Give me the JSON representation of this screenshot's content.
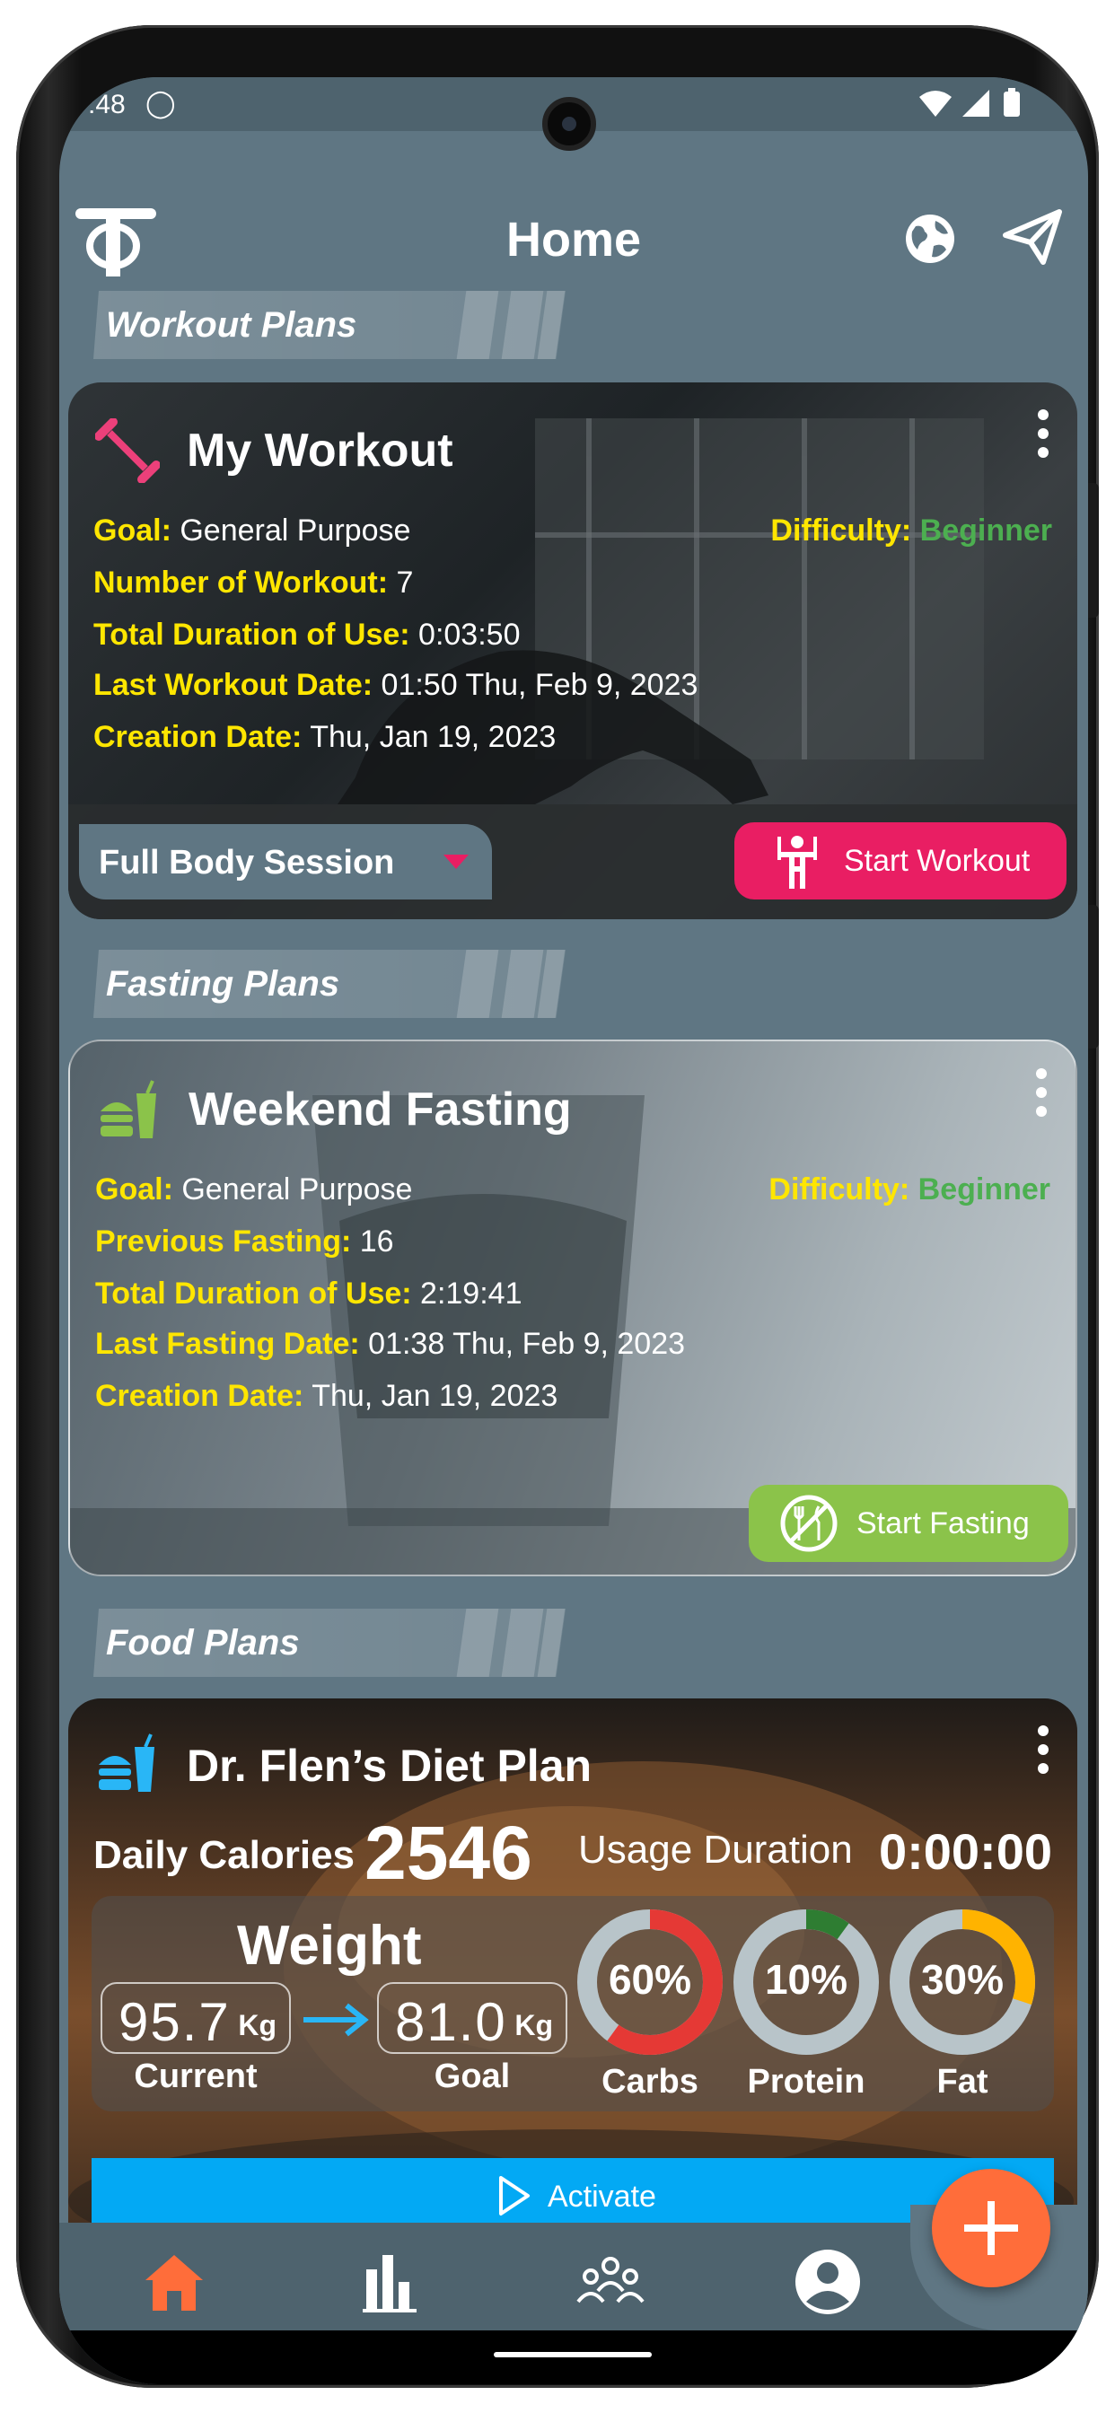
{
  "status_bar": {
    "time": ":48",
    "right_icons": "wifi signal battery"
  },
  "header": {
    "title": "Home"
  },
  "workout": {
    "section_label": "Workout Plans",
    "title": "My Workout",
    "goal_key": "Goal:",
    "goal_val": "General Purpose",
    "difficulty_key": "Difficulty:",
    "difficulty_val": "Beginner",
    "count_key": "Number of Workout:",
    "count_val": "7",
    "duration_key": "Total Duration of Use:",
    "duration_val": "0:03:50",
    "last_key": "Last Workout Date:",
    "last_val": "01:50 Thu, Feb 9, 2023",
    "created_key": "Creation Date:",
    "created_val": "Thu, Jan 19, 2023",
    "session_select": "Full Body Session",
    "start_label": "Start Workout"
  },
  "fasting": {
    "section_label": "Fasting Plans",
    "title": "Weekend Fasting",
    "goal_key": "Goal:",
    "goal_val": "General Purpose",
    "difficulty_key": "Difficulty:",
    "difficulty_val": "Beginner",
    "count_key": "Previous Fasting:",
    "count_val": "16",
    "duration_key": "Total Duration of Use:",
    "duration_val": "2:19:41",
    "last_key": "Last Fasting Date:",
    "last_val": "01:38 Thu, Feb 9, 2023",
    "created_key": "Creation Date:",
    "created_val": "Thu, Jan 19, 2023",
    "start_label": "Start Fasting"
  },
  "food": {
    "section_label": "Food Plans",
    "title": "Dr. Flen’s Diet Plan",
    "calories_label": "Daily Calories",
    "calories_value": "2546",
    "usage_label": "Usage Duration",
    "usage_value": "0:00:00",
    "weight_title": "Weight",
    "current_weight": "95.7",
    "goal_weight": "81.0",
    "unit": "Kg",
    "current_label": "Current",
    "goal_label": "Goal",
    "macros": [
      {
        "name": "Carbs",
        "percent": 60,
        "label": "60%",
        "color": "#e53935"
      },
      {
        "name": "Protein",
        "percent": 10,
        "label": "10%",
        "color": "#2e7d32"
      },
      {
        "name": "Fat",
        "percent": 30,
        "label": "30%",
        "color": "#ffb300"
      }
    ],
    "activate_label": "Activate"
  },
  "colors": {
    "accent_pink": "#e91e63",
    "accent_green": "#8bc34a",
    "accent_blue": "#03a9f4",
    "fab": "#ff6d3a",
    "bg": "#5f7683"
  },
  "nav": {
    "items": [
      "home-icon",
      "stats-icon",
      "community-icon",
      "profile-icon"
    ],
    "active": "home-icon"
  }
}
